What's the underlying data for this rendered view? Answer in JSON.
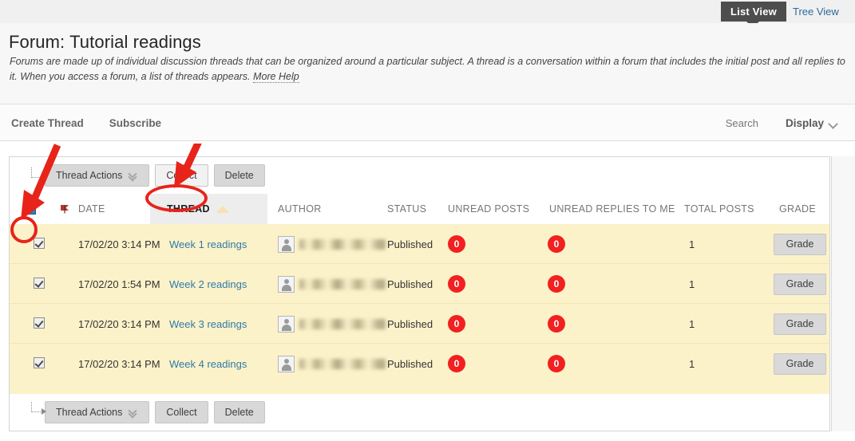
{
  "viewbar": {
    "active_tab": "List View",
    "inactive_tab": "Tree View",
    "active_bg": "#4d4d4d",
    "link_color": "#2c6a9e"
  },
  "header": {
    "title": "Forum: Tutorial readings",
    "description": "Forums are made up of individual discussion threads that can be organized around a particular subject. A thread is a conversation within a forum that includes the initial post and all replies to it. When you access a forum, a list of threads appears.",
    "more_help": "More Help"
  },
  "actionbar": {
    "create_thread": "Create Thread",
    "subscribe": "Subscribe",
    "search": "Search",
    "display": "Display",
    "display_chevron": "chevron-down-icon"
  },
  "toolbar": {
    "thread_actions": "Thread Actions",
    "thread_actions_chevron": "double-chevron-down-icon",
    "collect": "Collect",
    "delete": "Delete"
  },
  "table": {
    "select_all_checked": true,
    "columns": [
      "DATE",
      "THREAD",
      "AUTHOR",
      "STATUS",
      "UNREAD POSTS",
      "UNREAD REPLIES TO ME",
      "TOTAL POSTS",
      "GRADE"
    ],
    "sorted_column": "THREAD",
    "sort_direction": "ascending",
    "row_bg": "#fcf2c9",
    "badge_color": "#f22020",
    "link_color": "#2e7aab",
    "rows": [
      {
        "checked": true,
        "date": "17/02/20 3:14 PM",
        "thread": "Week 1 readings",
        "author": "",
        "status": "Published",
        "unread_posts": "0",
        "unread_replies_to_me": "0",
        "total_posts": "1",
        "grade": "Grade"
      },
      {
        "checked": true,
        "date": "17/02/20 1:54 PM",
        "thread": "Week 2 readings",
        "author": "",
        "status": "Published",
        "unread_posts": "0",
        "unread_replies_to_me": "0",
        "total_posts": "1",
        "grade": "Grade"
      },
      {
        "checked": true,
        "date": "17/02/20 3:14 PM",
        "thread": "Week 3 readings",
        "author": "",
        "status": "Published",
        "unread_posts": "0",
        "unread_replies_to_me": "0",
        "total_posts": "1",
        "grade": "Grade"
      },
      {
        "checked": true,
        "date": "17/02/20 3:14 PM",
        "thread": "Week 4 readings",
        "author": "",
        "status": "Published",
        "unread_posts": "0",
        "unread_replies_to_me": "0",
        "total_posts": "1",
        "grade": "Grade"
      }
    ]
  },
  "annotations": {
    "color": "#e8231a",
    "arrow_to_checkbox": "red-arrow-icon",
    "arrow_to_collect": "red-arrow-icon",
    "circle_checkbox": "red-ellipse-highlight",
    "circle_collect": "red-ellipse-highlight"
  }
}
